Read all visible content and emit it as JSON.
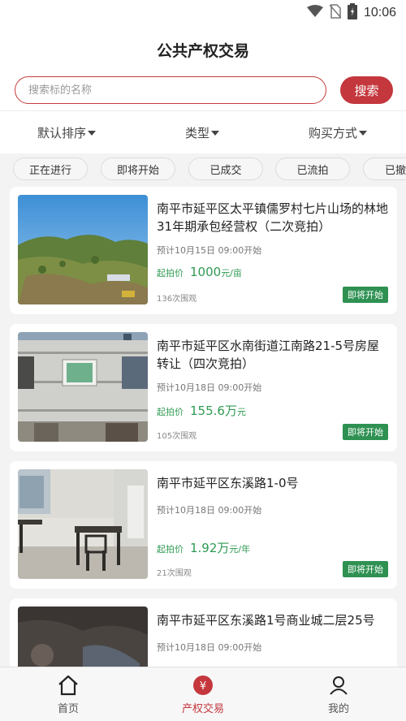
{
  "status_bar": {
    "time": "10:06"
  },
  "header": {
    "title": "公共产权交易"
  },
  "search": {
    "placeholder": "搜索标的名称",
    "button_label": "搜索"
  },
  "sort": [
    {
      "label": "默认排序"
    },
    {
      "label": "类型"
    },
    {
      "label": "购买方式"
    }
  ],
  "status_tabs": [
    {
      "label": "正在进行"
    },
    {
      "label": "即将开始"
    },
    {
      "label": "已成交"
    },
    {
      "label": "已流拍"
    },
    {
      "label": "已撤"
    }
  ],
  "listings": [
    {
      "title": "南平市延平区太平镇儒罗村七片山场的林地31年期承包经营权（二次竞拍）",
      "time": "预计10月15日 09:00开始",
      "price_label": "起拍价",
      "price": "1000",
      "price_unit": "元/亩",
      "views": "136次围观",
      "status": "即将开始"
    },
    {
      "title": "南平市延平区水南街道江南路21-5号房屋转让（四次竞拍）",
      "time": "预计10月18日 09:00开始",
      "price_label": "起拍价",
      "price": "155.6万",
      "price_unit": "元",
      "views": "105次围观",
      "status": "即将开始"
    },
    {
      "title": "南平市延平区东溪路1-0号",
      "time": "预计10月18日 09:00开始",
      "price_label": "起拍价",
      "price": "1.92万",
      "price_unit": "元/年",
      "views": "21次围观",
      "status": "即将开始"
    },
    {
      "title": "南平市延平区东溪路1号商业城二层25号",
      "time": "预计10月18日 09:00开始"
    }
  ],
  "bottom_nav": [
    {
      "label": "首页",
      "icon": "home-icon"
    },
    {
      "label": "产权交易",
      "icon": "yen-icon"
    },
    {
      "label": "我的",
      "icon": "user-icon"
    }
  ],
  "colors": {
    "accent": "#c4373d",
    "price_green": "#2f9a52",
    "badge_green": "#2e9152"
  }
}
